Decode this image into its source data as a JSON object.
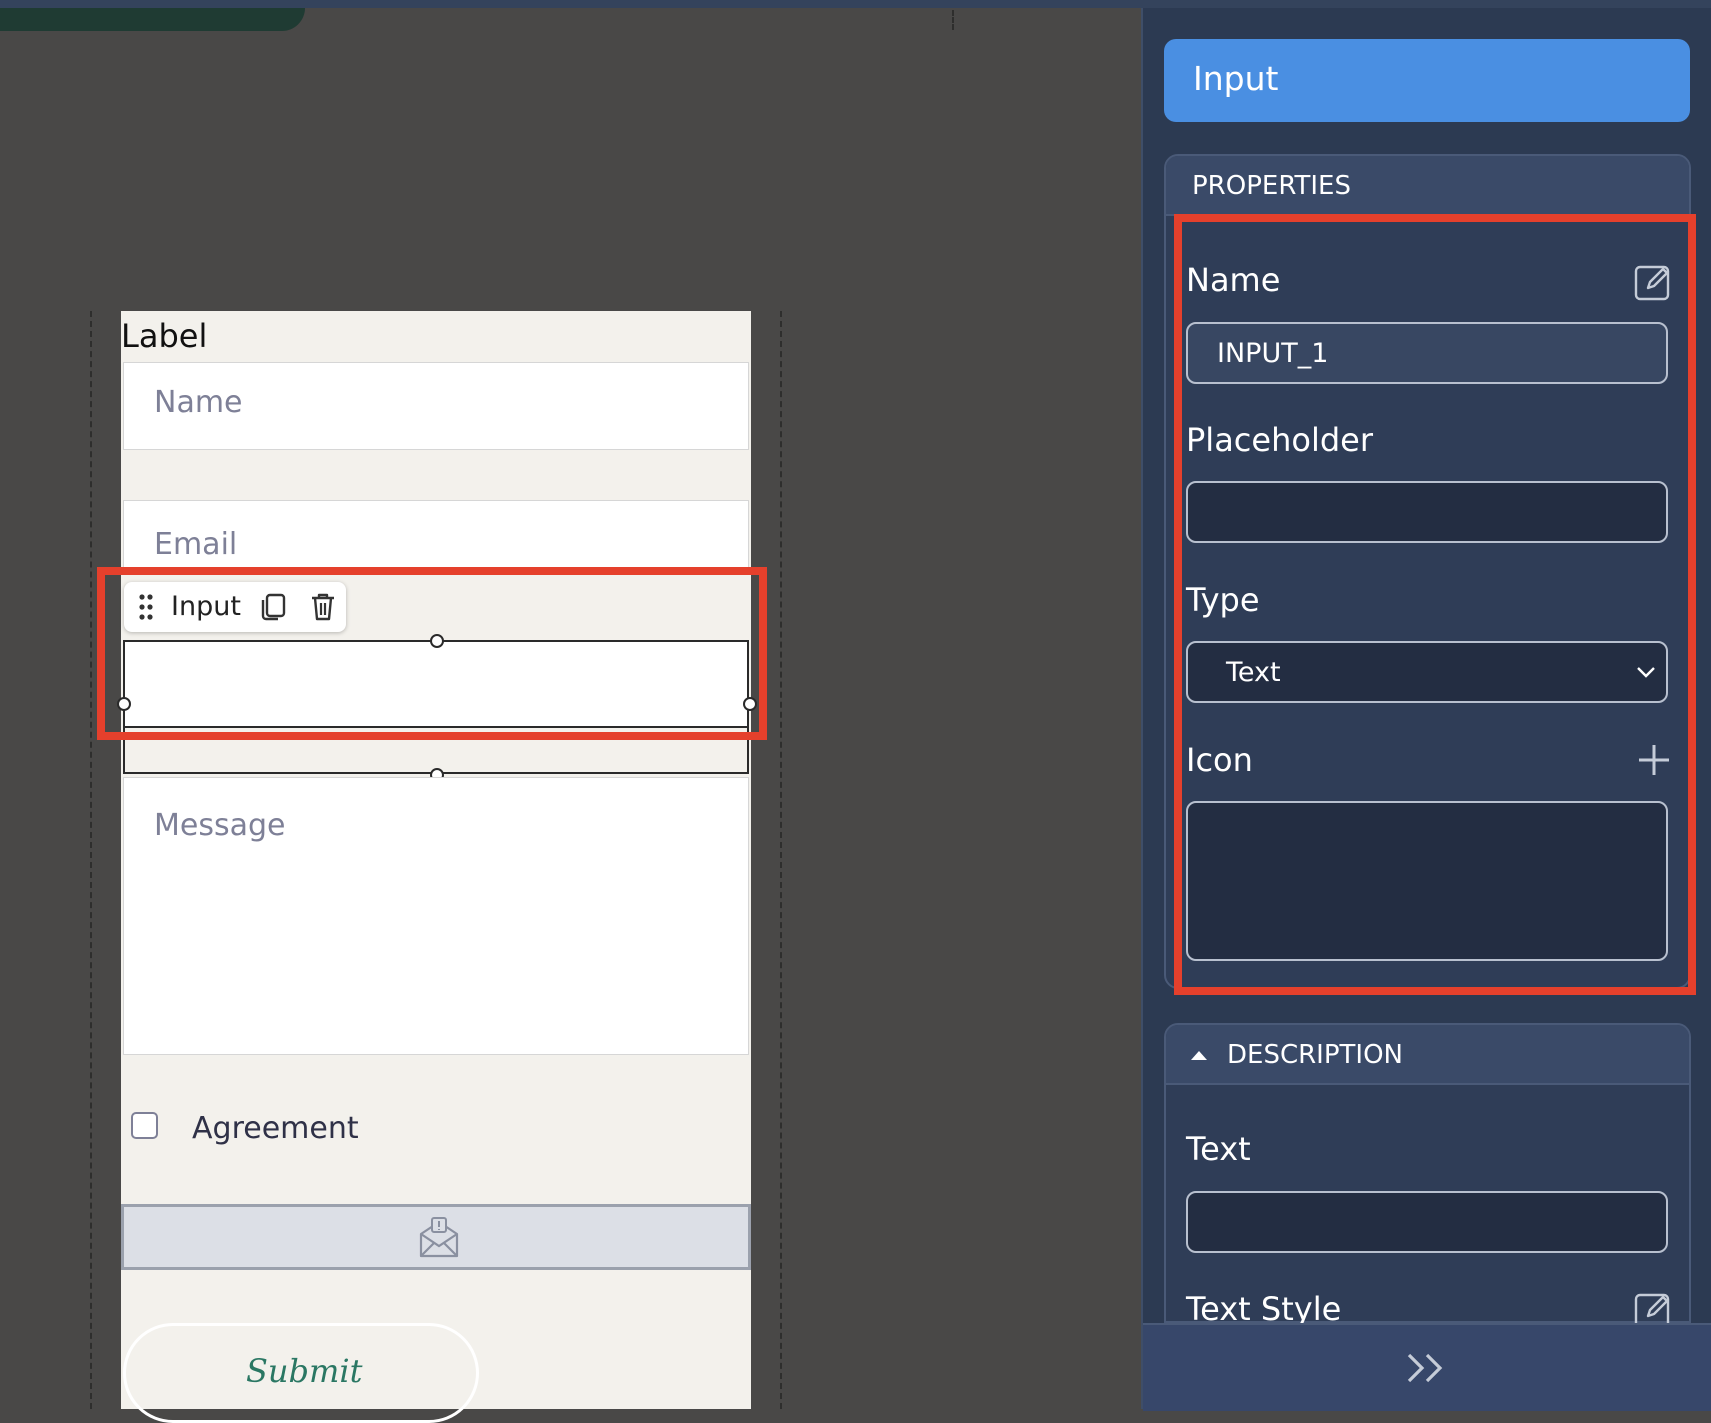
{
  "canvas": {
    "form_label": "Label",
    "fields": {
      "name_placeholder": "Name",
      "email_placeholder": "Email",
      "message_placeholder": "Message"
    },
    "selected_toolbar_label": "Input",
    "agreement_label": "Agreement",
    "submit_label": "Submit"
  },
  "panel": {
    "title": "Input",
    "properties": {
      "header": "PROPERTIES",
      "name_label": "Name",
      "name_value": "INPUT_1",
      "placeholder_label": "Placeholder",
      "placeholder_value": "",
      "type_label": "Type",
      "type_value": "Text",
      "icon_label": "Icon"
    },
    "description": {
      "header": "DESCRIPTION",
      "text_label": "Text",
      "text_value": "",
      "text_style_label": "Text Style"
    }
  },
  "colors": {
    "highlight": "#e5402c",
    "panel_title_bg": "#4a8fe2",
    "panel_bg": "#2c3a52",
    "canvas_bg": "#494847",
    "form_bg": "#f3f1ec",
    "submit_text": "#2a7763"
  },
  "icons": [
    "drag-grip-icon",
    "duplicate-icon",
    "trash-icon",
    "edit-icon",
    "chevron-down-icon",
    "plus-icon",
    "caret-up-icon",
    "envelope-icon",
    "double-chevron-right-icon"
  ]
}
